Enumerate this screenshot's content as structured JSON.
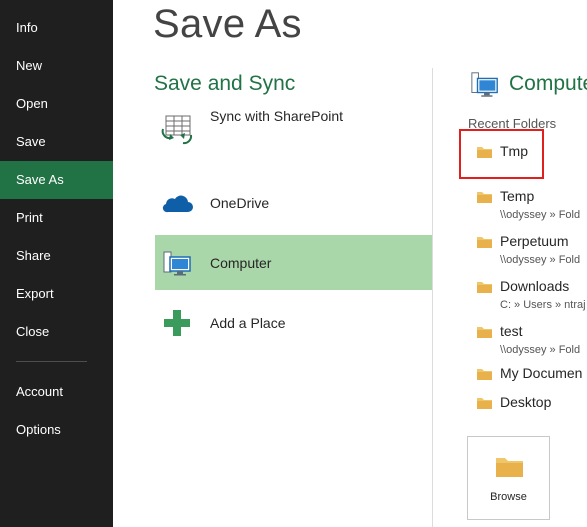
{
  "nav": {
    "items": [
      {
        "label": "Info"
      },
      {
        "label": "New"
      },
      {
        "label": "Open"
      },
      {
        "label": "Save"
      },
      {
        "label": "Save As",
        "active": true
      },
      {
        "label": "Print"
      },
      {
        "label": "Share"
      },
      {
        "label": "Export"
      },
      {
        "label": "Close"
      },
      {
        "label": "Account"
      },
      {
        "label": "Options"
      }
    ]
  },
  "page_title": "Save As",
  "places": {
    "heading": "Save and Sync",
    "items": [
      {
        "label": "Sync with SharePoint",
        "icon": "sharepoint-sync-icon"
      },
      {
        "label": "OneDrive",
        "icon": "onedrive-cloud-icon"
      },
      {
        "label": "Computer",
        "icon": "computer-icon",
        "selected": true
      },
      {
        "label": "Add a Place",
        "icon": "plus-icon"
      }
    ]
  },
  "computer": {
    "heading": "Computer",
    "recent_heading": "Recent Folders",
    "folders": [
      {
        "name": "Tmp",
        "path": ""
      },
      {
        "name": "Temp",
        "path": "\\\\odyssey » Fold"
      },
      {
        "name": "Perpetuum",
        "path": "\\\\odyssey » Fold"
      },
      {
        "name": "Downloads",
        "path": "C: » Users » ntraj"
      },
      {
        "name": "test",
        "path": "\\\\odyssey » Fold"
      },
      {
        "name": "My Documen",
        "path": ""
      },
      {
        "name": "Desktop",
        "path": ""
      }
    ],
    "browse_label": "Browse"
  },
  "colors": {
    "accent": "#217346",
    "selected_bg": "#a9d7a9",
    "nav_bg": "#1f1f1f",
    "highlight": "#e0201c"
  }
}
